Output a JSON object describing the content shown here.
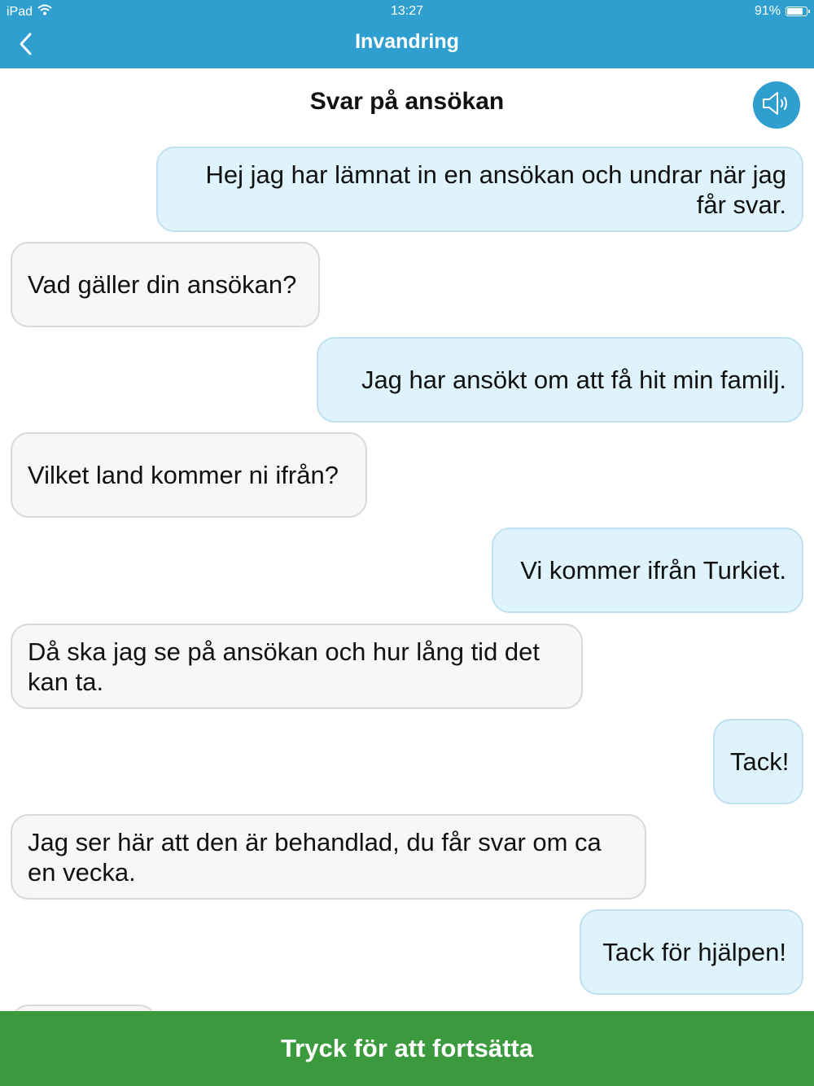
{
  "status_bar": {
    "device": "iPad",
    "time": "13:27",
    "battery": "91%",
    "battery_level": 0.91
  },
  "nav": {
    "title": "Invandring"
  },
  "conversation": {
    "title": "Svar på ansökan",
    "messages": [
      {
        "from": "me",
        "text": "Hej jag har lämnat in en ansökan och undrar när jag får svar."
      },
      {
        "from": "them",
        "text": "Vad gäller din ansökan?"
      },
      {
        "from": "me",
        "text": "Jag har ansökt om att få hit min familj."
      },
      {
        "from": "them",
        "text": "Vilket land kommer ni ifrån?"
      },
      {
        "from": "me",
        "text": "Vi kommer ifrån Turkiet."
      },
      {
        "from": "them",
        "text": "Då ska jag se på ansökan och hur lång tid det kan ta."
      },
      {
        "from": "me",
        "text": "Tack!"
      },
      {
        "from": "them",
        "text": "Jag ser här att den är behandlad, du får svar om ca en vecka."
      },
      {
        "from": "me",
        "text": "Tack för hjälpen!"
      }
    ]
  },
  "footer": {
    "continue_label": "Tryck för att fortsätta"
  },
  "colors": {
    "header": "#2f9fd0",
    "my_bubble": "#dff3fc",
    "their_bubble": "#f7f7f7",
    "continue_bar": "#3a9a3d"
  },
  "icons": {
    "back": "chevron-left-icon",
    "speaker": "speaker-icon",
    "wifi": "wifi-icon",
    "battery": "battery-icon"
  }
}
